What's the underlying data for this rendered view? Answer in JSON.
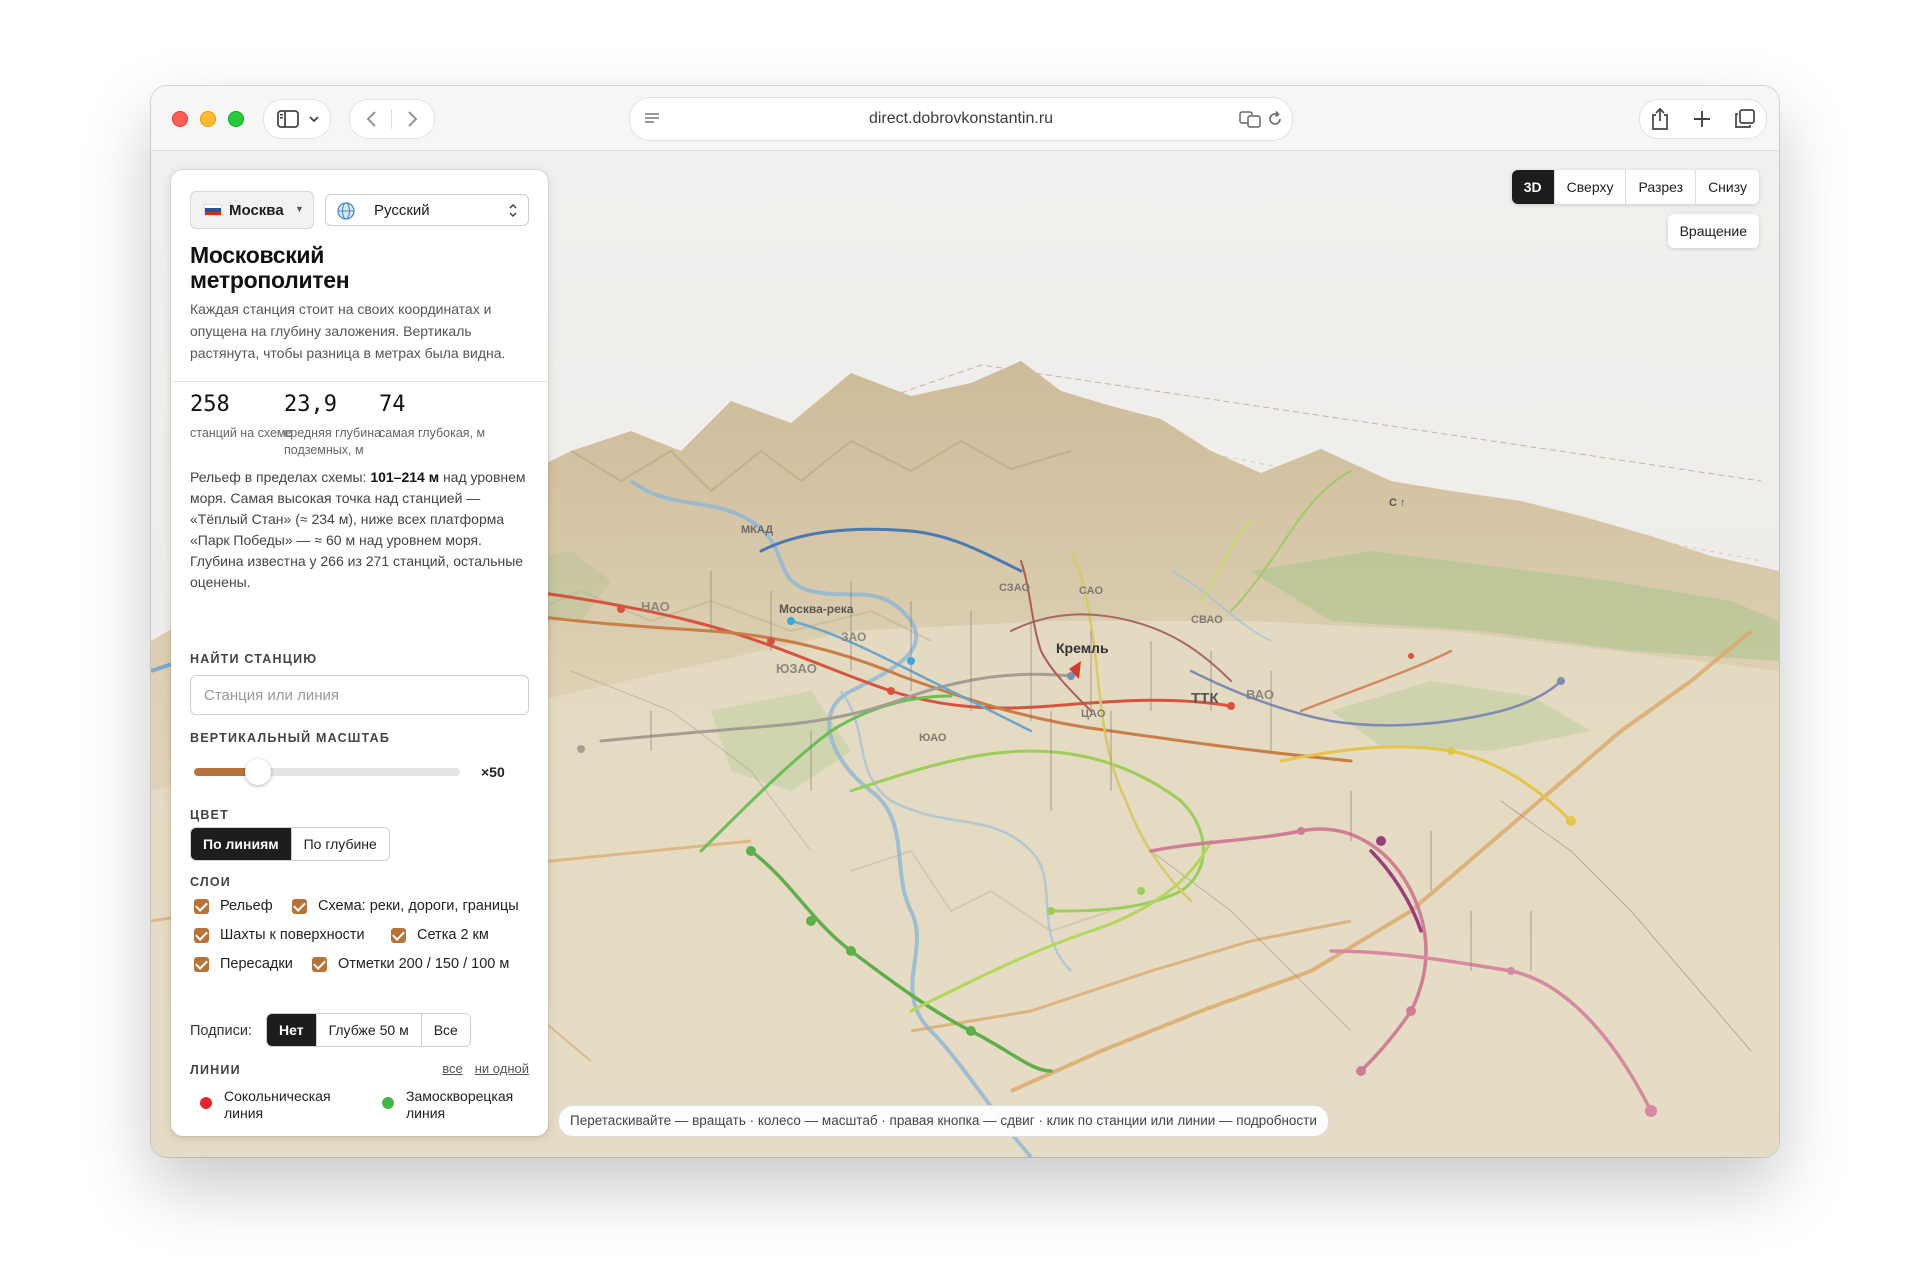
{
  "browser": {
    "url": "direct.dobrovkonstantin.ru"
  },
  "sidebar": {
    "city": "Москва",
    "language": "Русский",
    "title_line1": "Московский",
    "title_line2": "метрополитен",
    "description": "Каждая станция стоит на своих координатах и опущена на глубину заложения. Вертикаль растянута, чтобы разница в метрах была видна.",
    "stats": [
      {
        "value": "258",
        "label": "станций на схеме"
      },
      {
        "value": "23,9",
        "label": "средняя глубина подземных, м"
      },
      {
        "value": "74",
        "label": "самая глубокая, м"
      }
    ],
    "relief_prefix": "Рельеф в пределах схемы: ",
    "relief_range": "101–214 м",
    "relief_suffix": " над уровнем моря. Самая высокая точка над станцией — «Тёплый Стан» (≈ 234 м), ниже всех платформа «Парк Победы» — ≈ 60 м над уровнем моря.",
    "depth_note": "Глубина известна у 266 из 271 станций, остальные оценены.",
    "search_heading": "Найти станцию",
    "search_placeholder": "Станция или линия",
    "scale_heading": "Вертикальный масштаб",
    "scale_value": "×50",
    "scale_fraction": 0.24,
    "color_heading": "Цвет",
    "color_options": [
      "По линиям",
      "По глубине"
    ],
    "layers_heading": "Слои",
    "layers": [
      {
        "label": "Рельеф",
        "checked": true
      },
      {
        "label": "Схема: реки, дороги, границы",
        "checked": true
      },
      {
        "label": "Шахты к поверхности",
        "checked": true
      },
      {
        "label": "Сетка 2 км",
        "checked": true
      },
      {
        "label": "Пересадки",
        "checked": true
      },
      {
        "label": "Отметки 200 / 150 / 100 м",
        "checked": true
      }
    ],
    "labels_prefix": "Подписи:",
    "labels_options": [
      "Нет",
      "Глубже 50 м",
      "Все"
    ],
    "lines_heading": "Линии",
    "lines_all": "все",
    "lines_none": "ни одной",
    "lines": [
      {
        "name": "Сокольническая линия",
        "color": "#e2282e"
      },
      {
        "name": "Замоскворецкая линия",
        "color": "#45b549"
      }
    ]
  },
  "view": {
    "modes": [
      "3D",
      "Сверху",
      "Разрез",
      "Снизу"
    ],
    "active_mode": "3D",
    "rotate_label": "Вращение"
  },
  "map_labels": {
    "mkad": "МКАД",
    "river": "Москва-река",
    "kremlin": "Кремль",
    "ttk": "ТТК",
    "north": "С ↑",
    "districts": [
      "НАО",
      "ЗАО",
      "ЮЗАО",
      "СЗАО",
      "САО",
      "СВАО",
      "ВАО",
      "ЮАО",
      "ЦАО"
    ]
  },
  "hint": "Перетаскивайте — вращать · колесо — масштаб · правая кнопка — сдвиг · клик по станции или линии — подробности"
}
